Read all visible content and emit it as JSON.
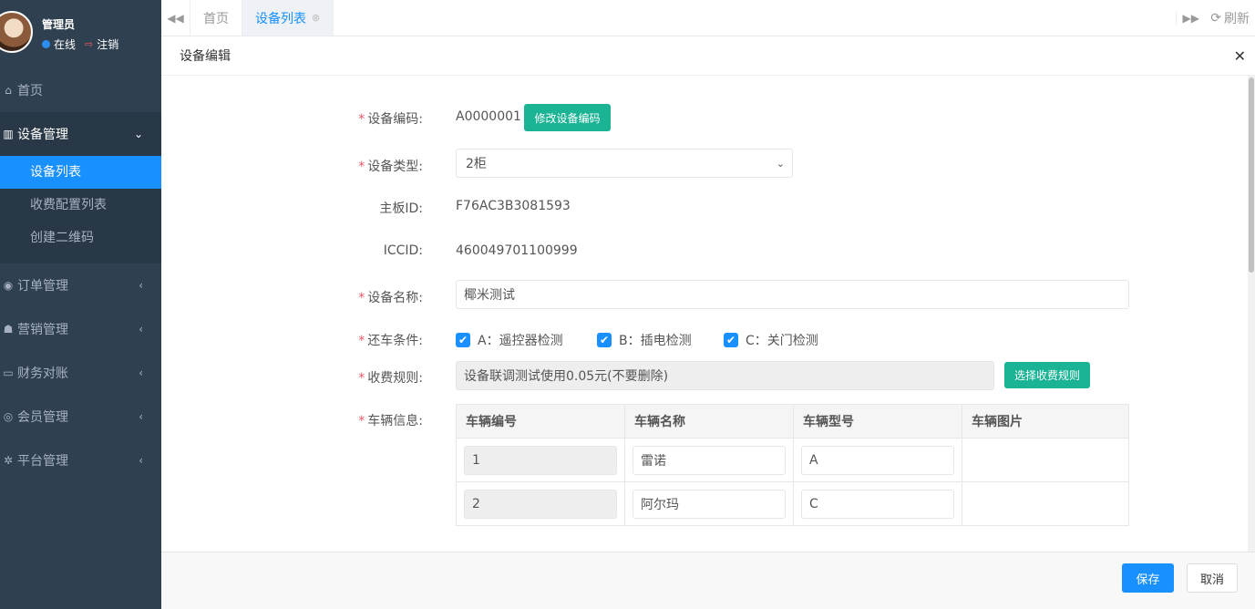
{
  "user": {
    "name": "管理员",
    "status": "在线",
    "logout": "注销"
  },
  "sidebar": {
    "items": [
      {
        "label": "首页",
        "icon": "home-icon"
      },
      {
        "label": "设备管理",
        "icon": "bank-icon"
      },
      {
        "label": "订单管理",
        "icon": "car-icon"
      },
      {
        "label": "营销管理",
        "icon": "users-icon"
      },
      {
        "label": "财务对账",
        "icon": "monitor-icon"
      },
      {
        "label": "会员管理",
        "icon": "user-circle-icon"
      },
      {
        "label": "平台管理",
        "icon": "gear-icon"
      }
    ],
    "sub_items": [
      "设备列表",
      "收费配置列表",
      "创建二维码"
    ]
  },
  "tabs": {
    "home": "首页",
    "device_list": "设备列表",
    "refresh": "刷新"
  },
  "modal": {
    "title": "设备编辑",
    "fields": {
      "code_label": "设备编码:",
      "code_value": "A0000001",
      "change_code_button": "修改设备编码",
      "type_label": "设备类型:",
      "type_value": "2柜",
      "board_label": "主板ID:",
      "board_value": "F76AC3B3081593",
      "iccid_label": "ICCID:",
      "iccid_value": "460049701100999",
      "name_label": "设备名称:",
      "name_value": "椰米测试",
      "return_label": "还车条件:",
      "return_options": [
        "A：遥控器检测",
        "B：插电检测",
        "C：关门检测"
      ],
      "fee_label": "收费规则:",
      "fee_value": "设备联调测试使用0.05元(不要删除)",
      "fee_button": "选择收费规则",
      "vehicle_label": "车辆信息:"
    },
    "table": {
      "headers": [
        "车辆编号",
        "车辆名称",
        "车辆型号",
        "车辆图片"
      ],
      "rows": [
        {
          "no": "1",
          "name": "雷诺",
          "model": "A"
        },
        {
          "no": "2",
          "name": "阿尔玛",
          "model": "C"
        }
      ]
    },
    "save": "保存",
    "cancel": "取消"
  }
}
